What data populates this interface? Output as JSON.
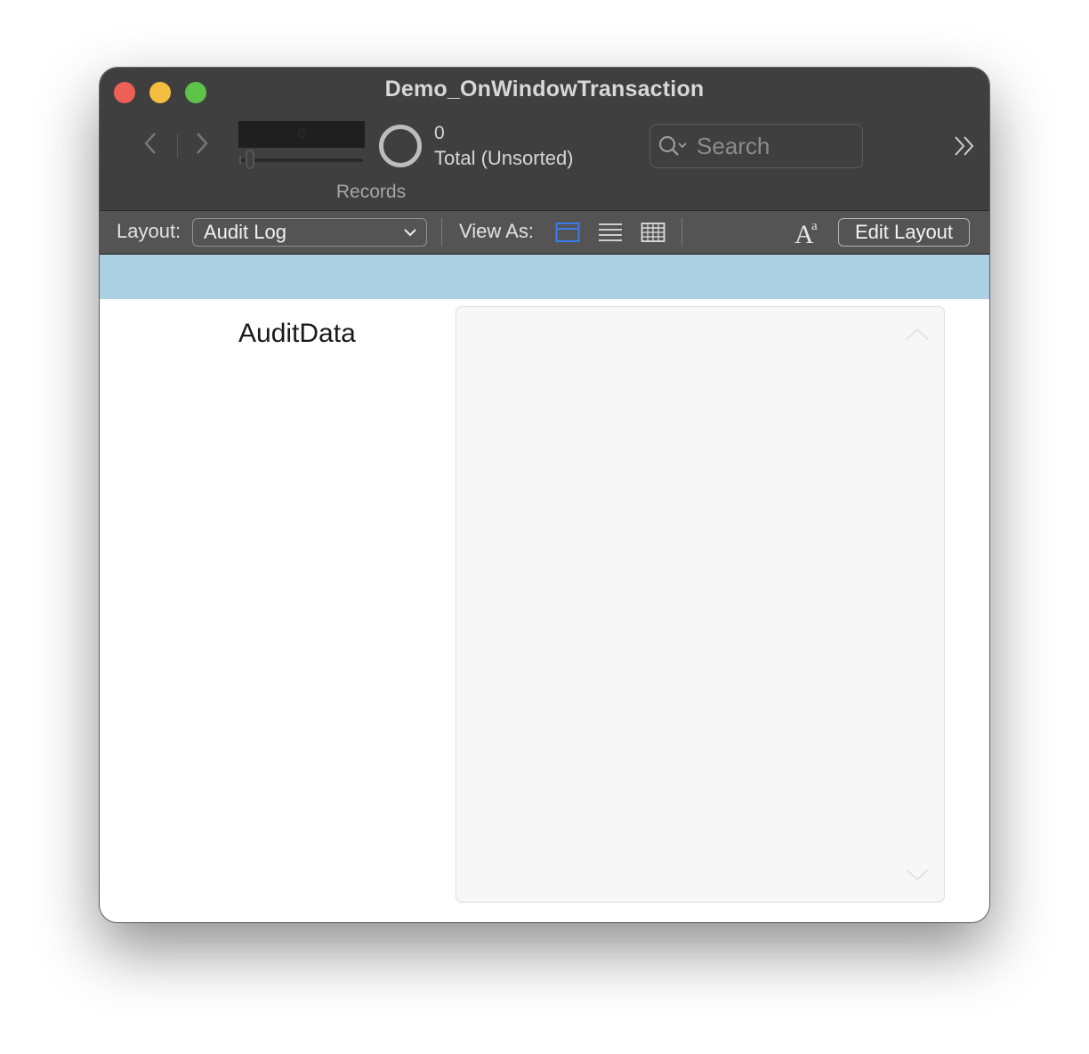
{
  "window": {
    "title": "Demo_OnWindowTransaction"
  },
  "toolbar": {
    "record_number": "0",
    "found_count": "0",
    "total_label": "Total (Unsorted)",
    "records_label": "Records",
    "search_placeholder": "Search"
  },
  "layout_bar": {
    "layout_label": "Layout:",
    "layout_value": "Audit Log",
    "view_as_label": "View As:",
    "active_view": "form",
    "edit_layout_label": "Edit Layout",
    "accent_color": "#3a7bf0"
  },
  "content": {
    "header_band_color": "#acd0e3",
    "field_label": "AuditData",
    "field_value": ""
  }
}
